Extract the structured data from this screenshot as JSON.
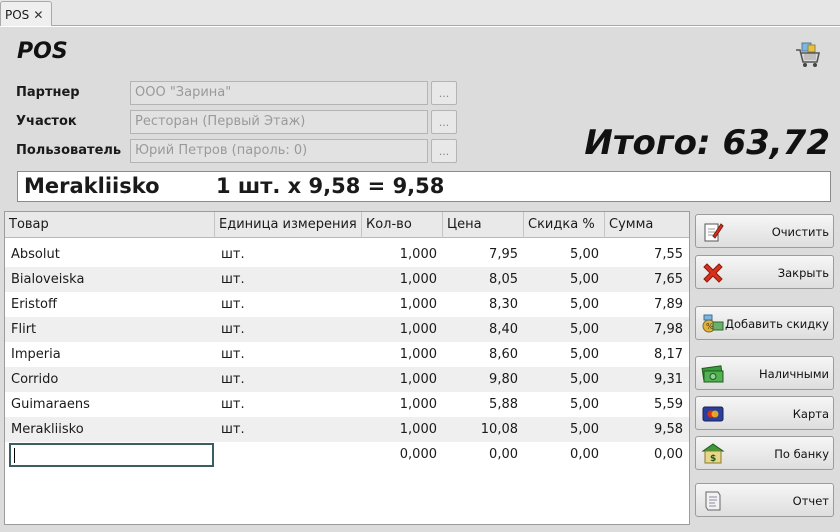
{
  "tab": {
    "label": "POS",
    "close": "✕"
  },
  "header": {
    "title": "POS"
  },
  "fields": [
    {
      "label": "Партнер",
      "value": "ООО \"Зарина\"",
      "more": "..."
    },
    {
      "label": "Участок",
      "value": "Ресторан (Первый Этаж)",
      "more": "..."
    },
    {
      "label": "Пользователь",
      "value": "Юрий Петров (пароль: 0)",
      "more": "..."
    }
  ],
  "total": {
    "label": "Итого: 63,72"
  },
  "last_item": {
    "product": "Merakliisko",
    "calc": "1 шт. x 9,58 = 9,58"
  },
  "table": {
    "columns": [
      "Товар",
      "Единица измерения",
      "Кол-во",
      "Цена",
      "Скидка %",
      "Сумма"
    ],
    "rows": [
      [
        "Absolut",
        "шт.",
        "1,000",
        "7,95",
        "5,00",
        "7,55"
      ],
      [
        "Bialoveiska",
        "шт.",
        "1,000",
        "8,05",
        "5,00",
        "7,65"
      ],
      [
        "Eristoff",
        "шт.",
        "1,000",
        "8,30",
        "5,00",
        "7,89"
      ],
      [
        "Flirt",
        "шт.",
        "1,000",
        "8,40",
        "5,00",
        "7,98"
      ],
      [
        "Imperia",
        "шт.",
        "1,000",
        "8,60",
        "5,00",
        "8,17"
      ],
      [
        "Corrido",
        "шт.",
        "1,000",
        "9,80",
        "5,00",
        "9,31"
      ],
      [
        "Guimaraens",
        "шт.",
        "1,000",
        "5,88",
        "5,00",
        "5,59"
      ],
      [
        "Merakliisko",
        "шт.",
        "1,000",
        "10,08",
        "5,00",
        "9,58"
      ]
    ],
    "entry": [
      "",
      "",
      "0,000",
      "0,00",
      "0,00",
      "0,00"
    ]
  },
  "buttons": [
    {
      "label": "Очистить",
      "icon": "clipboard-pen-icon"
    },
    {
      "label": "Закрыть",
      "icon": "red-x-icon"
    },
    {
      "label": "Добавить скидку",
      "icon": "discount-icon"
    },
    {
      "label": "Наличными",
      "icon": "cash-icon"
    },
    {
      "label": "Карта",
      "icon": "credit-card-icon"
    },
    {
      "label": "По банку",
      "icon": "bank-icon"
    },
    {
      "label": "Отчет",
      "icon": "report-icon"
    }
  ],
  "colors": {
    "accent_red": "#d9301c",
    "cash_green": "#3a9a3a",
    "edit_border": "#3d5e5e"
  }
}
